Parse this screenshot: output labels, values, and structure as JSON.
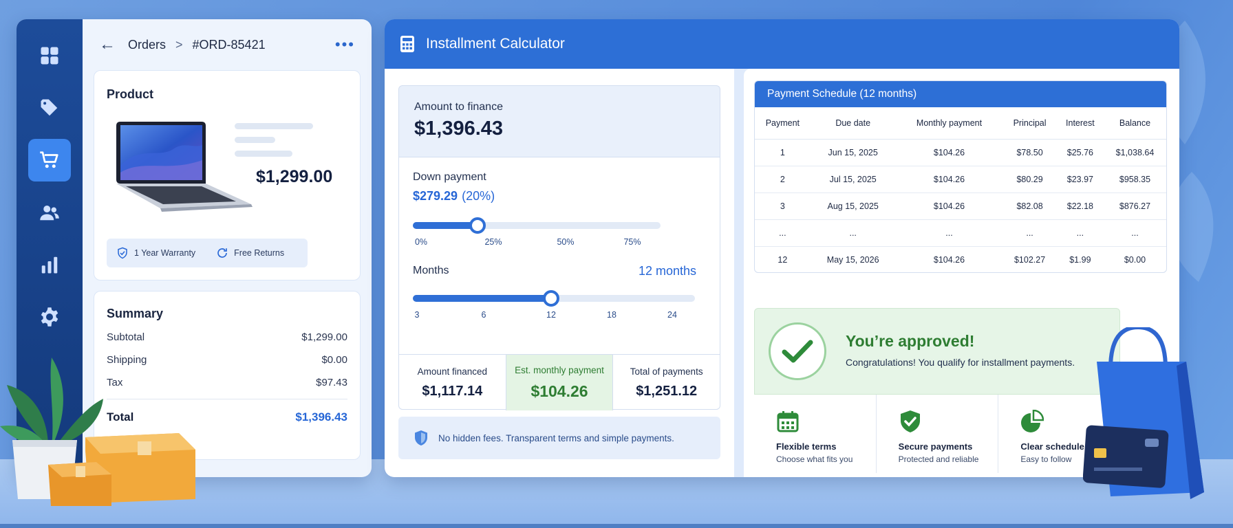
{
  "nav": {
    "items": [
      {
        "name": "dashboard-icon"
      },
      {
        "name": "tag-icon"
      },
      {
        "name": "cart-icon",
        "active": true
      },
      {
        "name": "users-icon"
      },
      {
        "name": "bar-chart-icon"
      },
      {
        "name": "gear-icon"
      }
    ]
  },
  "breadcrumb": {
    "section": "Orders",
    "separator": ">",
    "order_id": "#ORD-85421"
  },
  "product": {
    "title": "Product",
    "price": "$1,299.00",
    "badges": {
      "warranty": "1 Year Warranty",
      "returns": "Free Returns"
    }
  },
  "summary": {
    "title": "Summary",
    "rows": [
      {
        "label": "Subtotal",
        "value": "$1,299.00"
      },
      {
        "label": "Shipping",
        "value": "$0.00"
      },
      {
        "label": "Tax",
        "value": "$97.43"
      }
    ],
    "total_label": "Total",
    "total_value": "$1,396.43"
  },
  "calculator": {
    "title": "Installment Calculator",
    "amount_label": "Amount to finance",
    "amount_value": "$1,396.43",
    "down_payment": {
      "label": "Down payment",
      "value": "$279.29",
      "percent": "(20%)",
      "slider_value_percent": 20,
      "slider_max_percent": 80,
      "ticks": [
        "0%",
        "25%",
        "50%",
        "75%"
      ]
    },
    "months": {
      "label": "Months",
      "value": "12 months",
      "selected": 12,
      "ticks": [
        "3",
        "6",
        "12",
        "18",
        "24"
      ]
    },
    "results": [
      {
        "label": "Amount financed",
        "value": "$1,117.14"
      },
      {
        "label": "Est. monthly payment",
        "value": "$104.26"
      },
      {
        "label": "Total of payments",
        "value": "$1,251.12"
      }
    ],
    "note": "No hidden fees. Transparent terms and simple payments."
  },
  "schedule": {
    "title": "Payment Schedule (12 months)",
    "columns": [
      "Payment",
      "Due date",
      "Monthly payment",
      "Principal",
      "Interest",
      "Balance"
    ],
    "rows": [
      [
        "1",
        "Jun 15, 2025",
        "$104.26",
        "$78.50",
        "$25.76",
        "$1,038.64"
      ],
      [
        "2",
        "Jul 15, 2025",
        "$104.26",
        "$80.29",
        "$23.97",
        "$958.35"
      ],
      [
        "3",
        "Aug 15, 2025",
        "$104.26",
        "$82.08",
        "$22.18",
        "$876.27"
      ],
      [
        "...",
        "...",
        "...",
        "...",
        "...",
        "..."
      ],
      [
        "12",
        "May 15, 2026",
        "$104.26",
        "$102.27",
        "$1.99",
        "$0.00"
      ]
    ]
  },
  "approval": {
    "title": "You’re approved!",
    "subtitle": "Congratulations! You qualify for installment payments."
  },
  "features": [
    {
      "icon": "calendar-icon",
      "title": "Flexible terms",
      "subtitle": "Choose what fits you"
    },
    {
      "icon": "shield-check-icon",
      "title": "Secure payments",
      "subtitle": "Protected and reliable"
    },
    {
      "icon": "pie-chart-icon",
      "title": "Clear schedule",
      "subtitle": "Easy to follow"
    }
  ],
  "colors": {
    "primary": "#2d6fd6",
    "success": "#2e7d32",
    "sidebar": "#1d4c9a"
  }
}
